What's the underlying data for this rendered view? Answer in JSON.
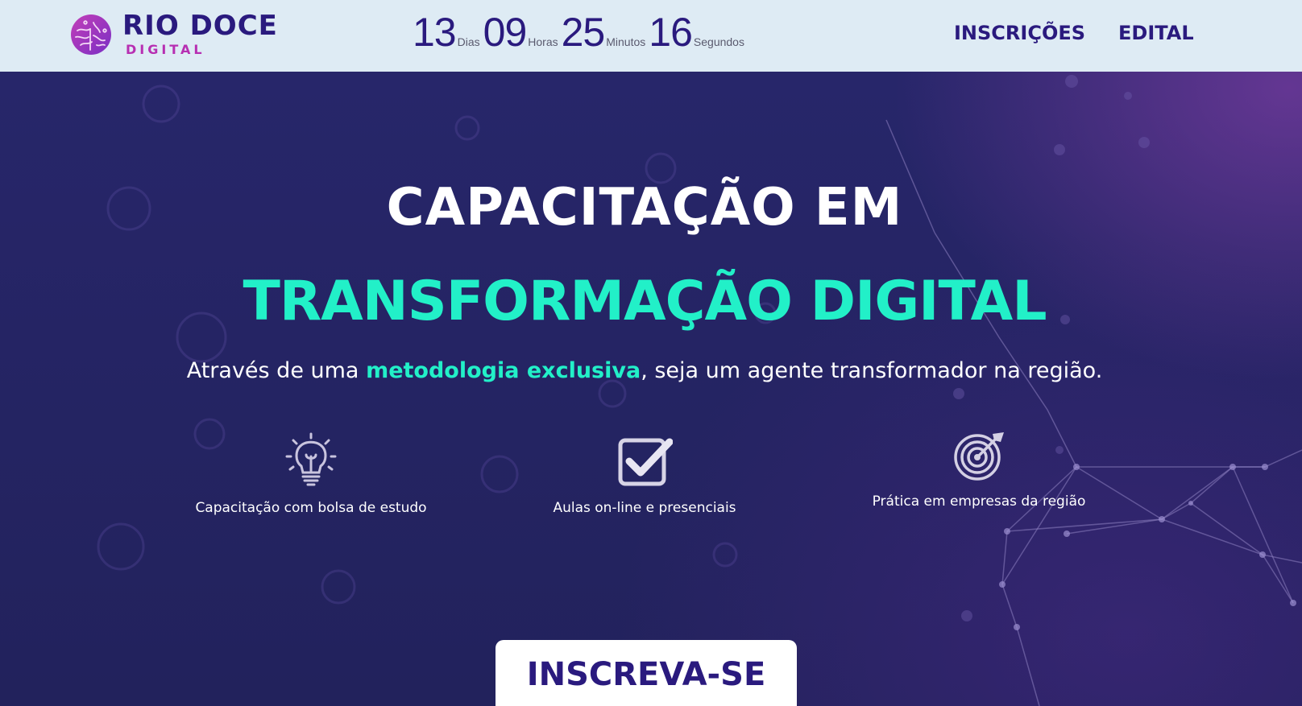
{
  "header": {
    "logo_title": "RIO DOCE",
    "logo_subtitle": "DIGITAL",
    "countdown": {
      "days": "13",
      "days_label": "Dias",
      "hours": "09",
      "hours_label": "Horas",
      "minutes": "25",
      "minutes_label": "Minutos",
      "seconds": "16",
      "seconds_label": "Segundos"
    },
    "nav": {
      "inscricoes": "INSCRIÇÕES",
      "edital": "EDITAL"
    }
  },
  "hero": {
    "title": "CAPACITAÇÃO EM",
    "highlight": "TRANSFORMAÇÃO DIGITAL",
    "subtitle_before": "Através de uma ",
    "subtitle_accent": "metodologia exclusiva",
    "subtitle_after": ", seja um agente transformador na região.",
    "features": [
      {
        "icon": "lightbulb-icon",
        "label": "Capacitação com bolsa de estudo"
      },
      {
        "icon": "checkbox-icon",
        "label": "Aulas on-line e presenciais"
      },
      {
        "icon": "target-icon",
        "label": "Prática em empresas da região"
      }
    ],
    "cta_label": "INSCREVA-SE"
  },
  "colors": {
    "brand_navy": "#2a1a7e",
    "brand_magenta": "#b72fb2",
    "accent_teal": "#22f0c8",
    "header_bg": "#deebf4",
    "hero_bg": "#24235e"
  }
}
